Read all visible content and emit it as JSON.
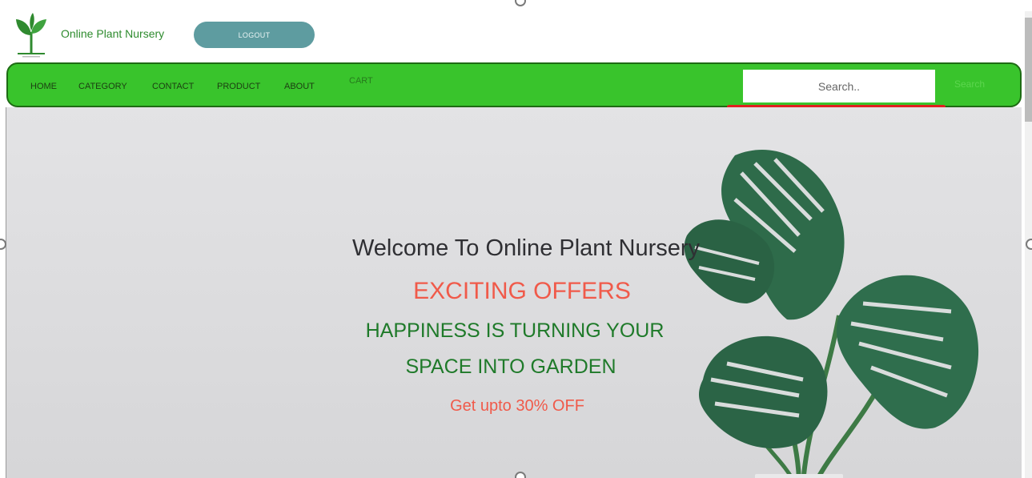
{
  "header": {
    "site_name": "Online Plant Nursery",
    "logout_label": "LOGOUT",
    "logo_icon": "sprout-logo-icon"
  },
  "nav": {
    "items": [
      {
        "label": "HOME"
      },
      {
        "label": "CATEGORY"
      },
      {
        "label": "CONTACT"
      },
      {
        "label": "PRODUCT"
      },
      {
        "label": "ABOUT"
      },
      {
        "label": "CART"
      }
    ],
    "search_placeholder": "Search..",
    "search_button_label": "Search"
  },
  "hero": {
    "welcome": "Welcome To Online Plant Nursery",
    "offers": "EXCITING OFFERS",
    "tagline_line1": "HAPPINESS IS TURNING YOUR",
    "tagline_line2": "SPACE INTO GARDEN",
    "discount": "Get upto 30% OFF"
  },
  "colors": {
    "nav_bg": "#39c42c",
    "nav_border": "#1e6b14",
    "logout_bg": "#5e9ca0",
    "offer_red": "#f05a4a",
    "tagline_green": "#1f7a2a",
    "search_underline": "#e02020"
  }
}
